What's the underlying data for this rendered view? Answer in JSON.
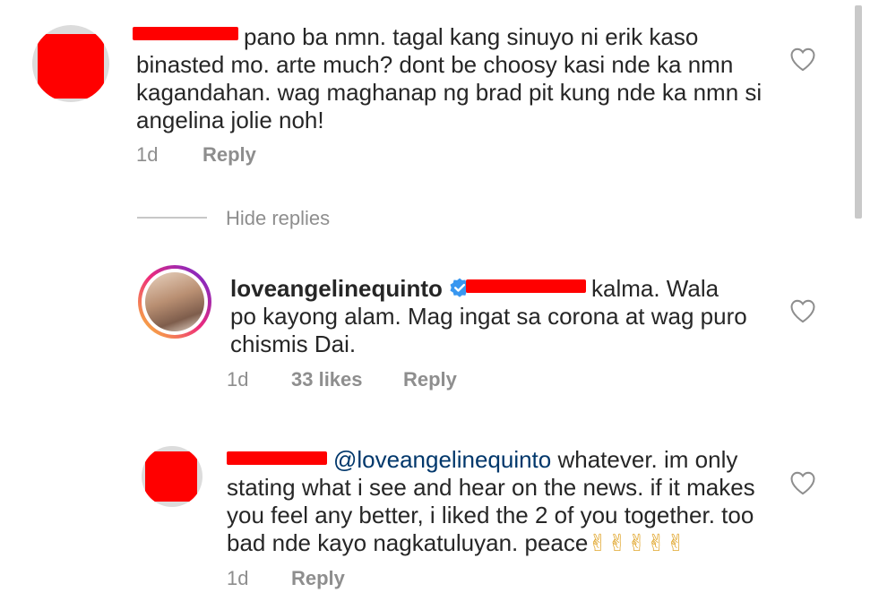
{
  "comments": [
    {
      "text": "pano ba nmn. tagal kang sinuyo ni erik kaso binasted mo. arte much? dont be choosy kasi nde ka nmn kagandahan. wag maghanap ng brad pit kung nde ka nmn si angelina jolie noh!",
      "line1": "pano ba nmn. tagal kang sinuyo ni erik kaso",
      "line2": "binasted mo. arte much? dont be choosy kasi nde ka nmn",
      "line3": "kagandahan. wag maghanap ng brad pit kung nde ka nmn si",
      "line4": "angelina jolie noh!",
      "time": "1d",
      "reply_label": "Reply"
    }
  ],
  "hide_replies": "Hide replies",
  "replies": [
    {
      "username": "loveangelinequinto",
      "verified": true,
      "line1_after_mention": "kalma. Wala",
      "line2": "po kayong alam. Mag ingat sa corona at wag puro",
      "line3": "chismis Dai.",
      "time": "1d",
      "likes": "33 likes",
      "reply_label": "Reply"
    },
    {
      "mention": "@loveangelinequinto",
      "line1_after_mention": "whatever. im only",
      "line2": "stating what i see and hear on the news. if it makes",
      "line3": "you feel any better, i liked the 2 of you together. too",
      "line4": "bad nde kayo nagkatuluyan. peace",
      "emoji": "✌✌✌✌✌",
      "time": "1d",
      "reply_label": "Reply"
    }
  ],
  "icons": {
    "like": "heart-outline-icon",
    "verified": "verified-badge-icon"
  },
  "colors": {
    "text": "#262626",
    "meta": "#8e8e8e",
    "mention": "#00376b",
    "verified": "#3897f0",
    "redaction": "#ff0000"
  }
}
